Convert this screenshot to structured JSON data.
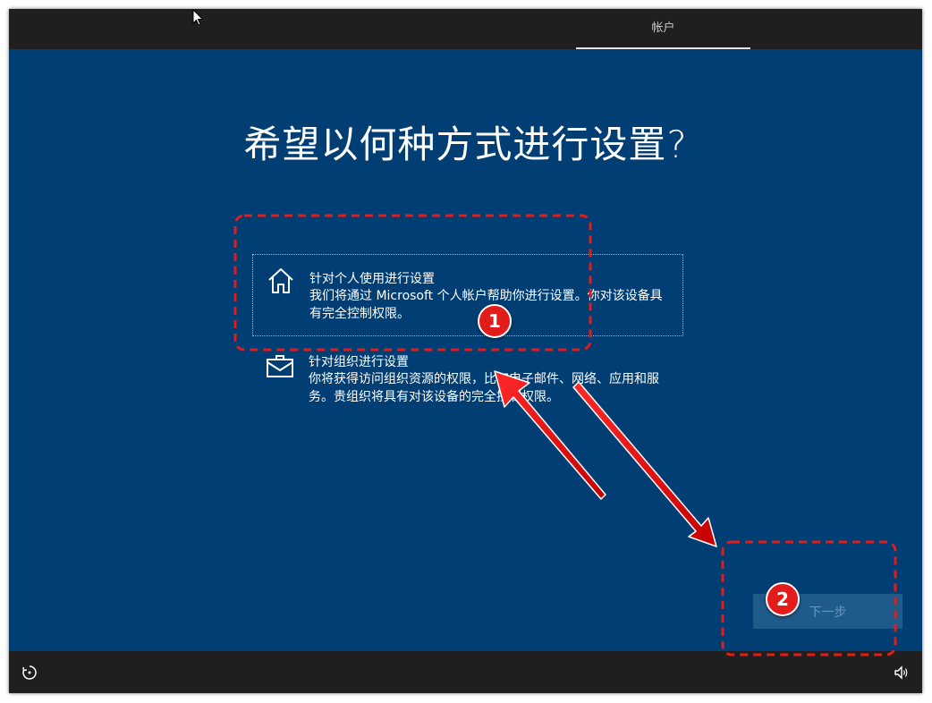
{
  "header": {
    "tab_label": "帐户"
  },
  "main": {
    "heading": "希望以何种方式进行设置?",
    "options": [
      {
        "title": "针对个人使用进行设置",
        "description": "我们将通过 Microsoft 个人帐户帮助你进行设置。你对该设备具有完全控制权限。",
        "icon": "home-icon",
        "selected": true
      },
      {
        "title": "针对组织进行设置",
        "description": "你将获得访问组织资源的权限，比如电子邮件、网络、应用和服务。贵组织将具有对该设备的完全控制权限。",
        "icon": "briefcase-icon",
        "selected": false
      }
    ],
    "next_label": "下一步"
  },
  "annotations": [
    {
      "label": "1"
    },
    {
      "label": "2"
    }
  ],
  "footer": {
    "left_icon": "accessibility-icon",
    "right_icon": "volume-icon"
  },
  "colors": {
    "background": "#003e73",
    "bar": "#1f1f1f",
    "annotation": "#e21b1b"
  }
}
